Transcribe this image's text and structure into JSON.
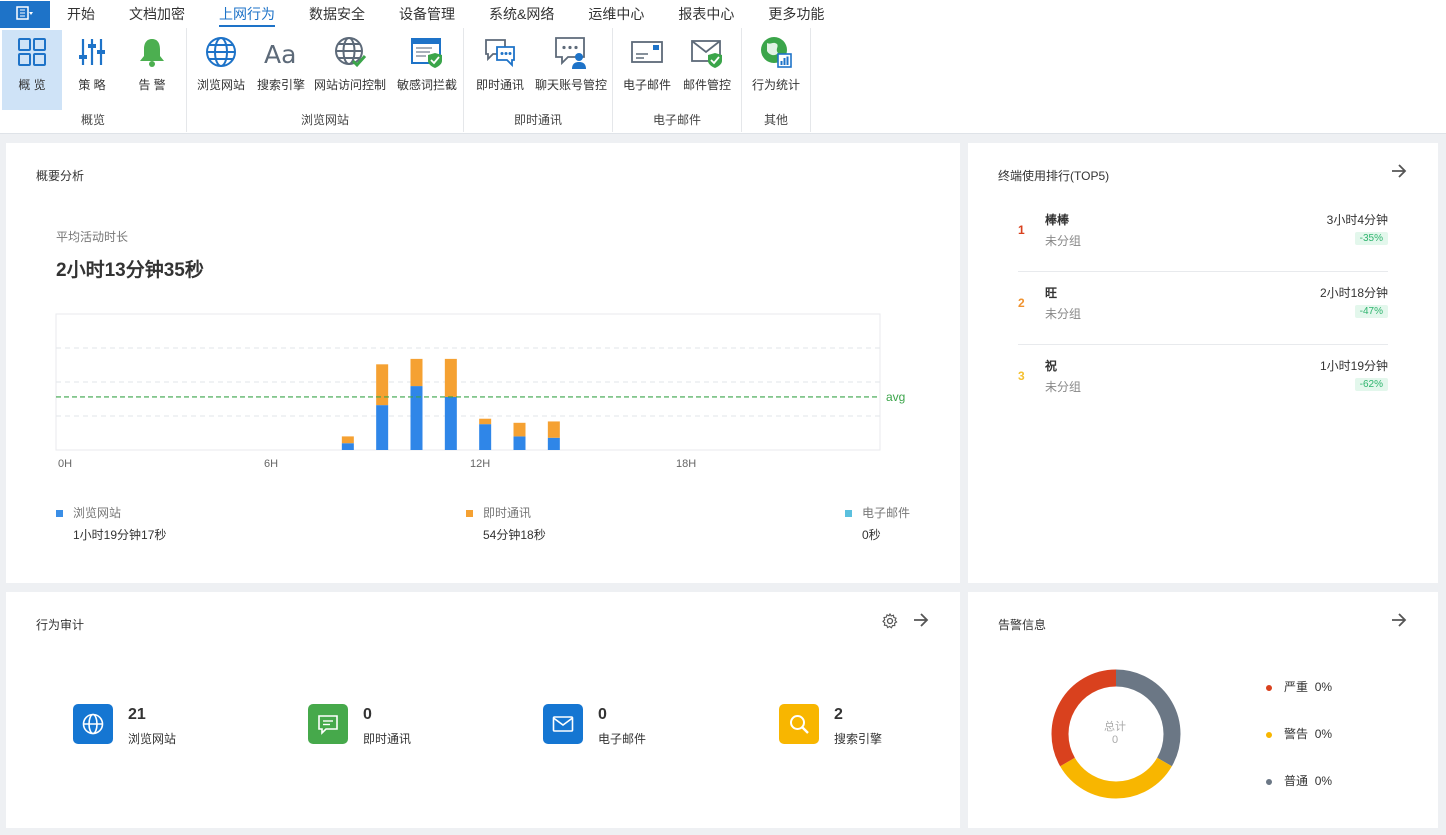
{
  "menu": {
    "app_icon": "menu-icon",
    "tabs": [
      {
        "label": "开始",
        "active": false
      },
      {
        "label": "文档加密",
        "active": false
      },
      {
        "label": "上网行为",
        "active": true
      },
      {
        "label": "数据安全",
        "active": false
      },
      {
        "label": "设备管理",
        "active": false
      },
      {
        "label": "系统&网络",
        "active": false
      },
      {
        "label": "运维中心",
        "active": false
      },
      {
        "label": "报表中心",
        "active": false
      },
      {
        "label": "更多功能",
        "active": false
      }
    ]
  },
  "ribbon": {
    "groups": [
      {
        "label": "概览",
        "buttons": [
          {
            "label": "概 览",
            "icon": "grid-icon",
            "selected": true
          },
          {
            "label": "策 略",
            "icon": "sliders-icon"
          },
          {
            "label": "告 警",
            "icon": "bell-icon"
          }
        ]
      },
      {
        "label": "浏览网站",
        "buttons": [
          {
            "label": "浏览网站",
            "icon": "globe-icon"
          },
          {
            "label": "搜索引擎",
            "icon": "font-aa-icon"
          },
          {
            "label": "网站访问控制",
            "icon": "globe-check-icon"
          },
          {
            "label": "敏感词拦截",
            "icon": "window-shield-icon"
          }
        ]
      },
      {
        "label": "即时通讯",
        "buttons": [
          {
            "label": "即时通讯",
            "icon": "chat-bubbles-icon"
          },
          {
            "label": "聊天账号管控",
            "icon": "chat-user-icon"
          }
        ]
      },
      {
        "label": "电子邮件",
        "buttons": [
          {
            "label": "电子邮件",
            "icon": "envelope-icon"
          },
          {
            "label": "邮件管控",
            "icon": "envelope-shield-icon"
          }
        ]
      },
      {
        "label": "其他",
        "buttons": [
          {
            "label": "行为统计",
            "icon": "globe-stats-icon"
          }
        ]
      }
    ]
  },
  "overview": {
    "title": "概要分析",
    "avg_label": "平均活动时长",
    "avg_value": "2小时13分钟35秒",
    "legend": [
      {
        "name": "浏览网站",
        "value": "1小时19分钟17秒",
        "color": "#3a8ee6"
      },
      {
        "name": "即时通讯",
        "value": "54分钟18秒",
        "color": "#f5a132"
      },
      {
        "name": "电子邮件",
        "value": "0秒",
        "color": "#5bc0de"
      }
    ]
  },
  "chart_data": {
    "type": "bar",
    "stacked": true,
    "x_ticks": [
      "0H",
      "6H",
      "12H",
      "18H"
    ],
    "x_range": [
      0,
      24
    ],
    "hours": [
      8,
      9,
      10,
      11,
      12,
      13,
      14
    ],
    "series": [
      {
        "name": "浏览网站",
        "color": "#2f86e8",
        "values": [
          0.05,
          0.33,
          0.47,
          0.39,
          0.19,
          0.1,
          0.09
        ]
      },
      {
        "name": "即时通讯",
        "color": "#f5a132",
        "values": [
          0.05,
          0.3,
          0.2,
          0.28,
          0.04,
          0.1,
          0.12
        ]
      },
      {
        "name": "电子邮件",
        "color": "#5bc0de",
        "values": [
          0,
          0,
          0,
          0,
          0,
          0,
          0
        ]
      }
    ],
    "ylim": [
      0,
      1
    ],
    "avg_line": 0.39,
    "avg_line_label": "avg",
    "avg_color": "#3ba54a",
    "grid": true
  },
  "ranking": {
    "title": "终端使用排行(TOP5)",
    "items": [
      {
        "rank": "1",
        "name": "棒棒",
        "group": "未分组",
        "time": "3小时4分钟",
        "change": "-35%",
        "color": "#d9411e"
      },
      {
        "rank": "2",
        "name": "旺",
        "group": "未分组",
        "time": "2小时18分钟",
        "change": "-47%",
        "color": "#f0922e"
      },
      {
        "rank": "3",
        "name": "祝",
        "group": "未分组",
        "time": "1小时19分钟",
        "change": "-62%",
        "color": "#f5c030"
      }
    ]
  },
  "audit": {
    "title": "行为审计",
    "items": [
      {
        "num": "21",
        "label": "浏览网站",
        "icon": "globe-icon",
        "color": "#1576d2"
      },
      {
        "num": "0",
        "label": "即时通讯",
        "icon": "chat-icon",
        "color": "#46a94b"
      },
      {
        "num": "0",
        "label": "电子邮件",
        "icon": "envelope-icon",
        "color": "#1576d2"
      },
      {
        "num": "2",
        "label": "搜索引擎",
        "icon": "search-icon",
        "color": "#f8b600"
      }
    ]
  },
  "alerts": {
    "title": "告警信息",
    "total_label": "总计",
    "total_value": "0",
    "levels": [
      {
        "name": "严重",
        "pct": "0%",
        "color": "#d9411e"
      },
      {
        "name": "警告",
        "pct": "0%",
        "color": "#f8b600"
      },
      {
        "name": "普通",
        "pct": "0%",
        "color": "#6b7785"
      }
    ]
  }
}
